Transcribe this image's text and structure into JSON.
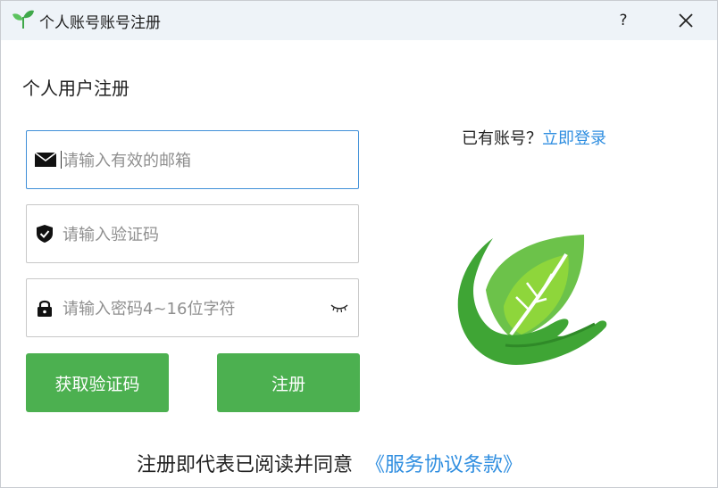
{
  "window": {
    "title": "个人账号账号注册",
    "help_label": "?",
    "close_icon": "close-icon",
    "app_icon": "sprout-icon"
  },
  "form": {
    "heading": "个人用户注册",
    "email": {
      "placeholder": "请输入有效的邮箱",
      "value": "",
      "icon": "envelope-icon",
      "focused": true
    },
    "code": {
      "placeholder": "请输入验证码",
      "value": "",
      "icon": "shield-check-icon"
    },
    "password": {
      "placeholder": "请输入密码4~16位字符",
      "value": "",
      "icon": "lock-icon",
      "toggle_icon": "eye-closed-icon"
    },
    "get_code_label": "获取验证码",
    "register_label": "注册"
  },
  "login": {
    "prompt": "已有账号？",
    "link_label": "立即登录"
  },
  "agreement": {
    "text": "注册即代表已阅读并同意",
    "link_label": "《服务协议条款》"
  },
  "colors": {
    "accent_green": "#4cb050",
    "link_blue": "#2f8ee0",
    "focus_border": "#3f8fd8",
    "titlebar_bg": "#eef3f8"
  }
}
